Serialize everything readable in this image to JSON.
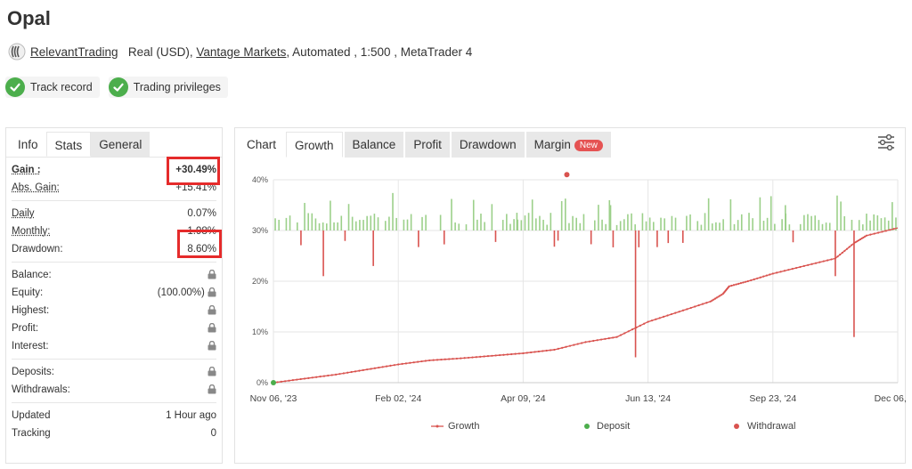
{
  "title": "Opal",
  "account": {
    "owner": "RelevantTrading",
    "type": "Real (USD),",
    "broker": "Vantage Markets",
    "details": ", Automated , 1:500 , MetaTrader 4"
  },
  "badges": [
    "Track record",
    "Trading privileges"
  ],
  "stats_tabs": [
    "Info",
    "Stats",
    "General"
  ],
  "stats": {
    "gain": {
      "label": "Gain :",
      "value": "+30.49%"
    },
    "abs_gain": {
      "label": "Abs. Gain:",
      "value": "+15.41%"
    },
    "daily": {
      "label": "Daily",
      "value": "0.07%"
    },
    "monthly": {
      "label": "Monthly:",
      "value": "1.98%"
    },
    "drawdown": {
      "label": "Drawdown:",
      "value": "8.60%"
    },
    "balance": {
      "label": "Balance:"
    },
    "equity": {
      "label": "Equity:",
      "value": "(100.00%)"
    },
    "highest": {
      "label": "Highest:"
    },
    "profit": {
      "label": "Profit:"
    },
    "interest": {
      "label": "Interest:"
    },
    "deposits": {
      "label": "Deposits:"
    },
    "withdrawals": {
      "label": "Withdrawals:"
    },
    "updated": {
      "label": "Updated",
      "value": "1 Hour ago"
    },
    "tracking": {
      "label": "Tracking",
      "value": "0"
    }
  },
  "chart_tabs": [
    "Chart",
    "Growth",
    "Balance",
    "Profit",
    "Drawdown",
    "Margin"
  ],
  "new_badge": "New",
  "colors": {
    "accent_green": "#4cae4c",
    "highlight_red": "#e52b2b",
    "growth_red": "#d9534f",
    "bar_green": "#9cd08a"
  },
  "chart_data": {
    "type": "line",
    "y_ticks": [
      "0%",
      "10%",
      "20%",
      "30%",
      "40%"
    ],
    "ylim": [
      0,
      40
    ],
    "x_ticks": [
      "Nov 06, '23",
      "Feb 02, '24",
      "Apr 09, '24",
      "Jun 13, '24",
      "Sep 23, '24",
      "Dec 06, '24"
    ],
    "legend": [
      "Growth",
      "Deposit",
      "Withdrawal"
    ],
    "legend_position": "bottom",
    "grid": true,
    "series": [
      {
        "name": "Growth",
        "x": [
          0,
          0.05,
          0.1,
          0.15,
          0.2,
          0.25,
          0.3,
          0.35,
          0.4,
          0.45,
          0.5,
          0.55,
          0.6,
          0.65,
          0.7,
          0.72,
          0.73,
          0.76,
          0.8,
          0.85,
          0.9,
          0.93,
          0.95,
          1.0
        ],
        "values": [
          0,
          0.8,
          1.6,
          2.6,
          3.6,
          4.4,
          4.8,
          5.3,
          5.8,
          6.5,
          8.0,
          9.0,
          12.0,
          14.0,
          16.0,
          17.5,
          19.0,
          20.0,
          21.5,
          23.0,
          24.5,
          27.5,
          29.0,
          30.5
        ]
      }
    ],
    "events": {
      "deposit_x": 0.0,
      "withdrawal_x": 0.47
    }
  }
}
